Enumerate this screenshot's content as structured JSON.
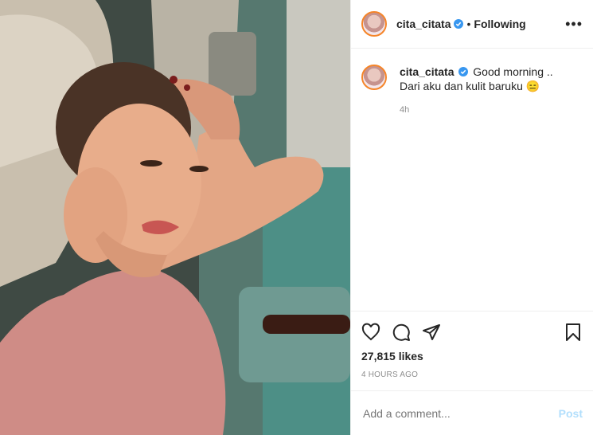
{
  "post": {
    "username": "cita_citata",
    "follow_status": "Following",
    "separator": "•",
    "more_icon": "more-options-icon",
    "caption_line1": "Good morning ..",
    "caption_line2": "Dari aku dan kulit baruku",
    "caption_emoji": "😑",
    "caption_time": "4h",
    "likes": "27,815 likes",
    "timestamp": "4 HOURS AGO",
    "comment_placeholder": "Add a comment...",
    "post_button": "Post"
  },
  "colors": {
    "verified": "#3897f0",
    "post_button": "#b2dffc",
    "muted": "#8e8e8e"
  }
}
